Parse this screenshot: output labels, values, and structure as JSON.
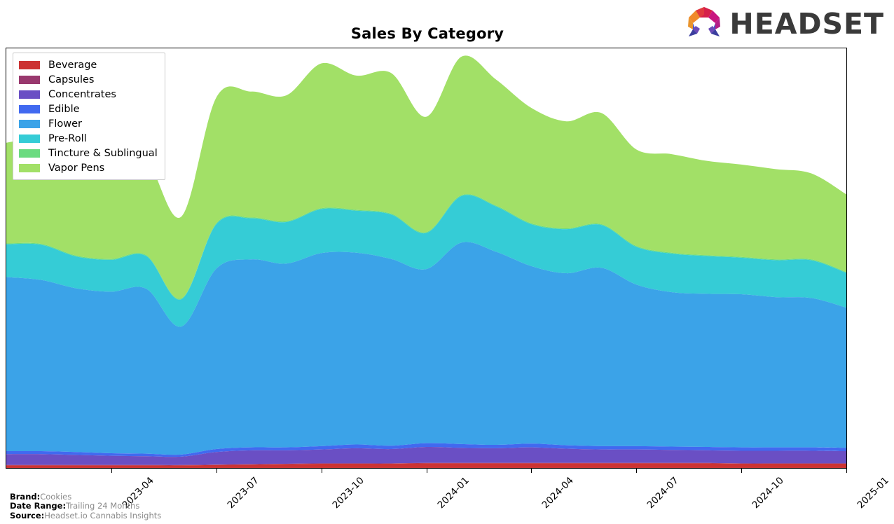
{
  "header": {
    "title": "Sales By Category",
    "logo_word": "HEADSET",
    "logo_icon": "headset-arch-logo"
  },
  "footer": {
    "brand_key": "Brand:",
    "brand_val": "Cookies",
    "date_range_key": "Date Range:",
    "date_range_val": "Trailing 24 Months",
    "source_key": "Source:",
    "source_val": "Headset.io Cannabis Insights"
  },
  "chart_data": {
    "type": "area",
    "stacked": true,
    "title": "Sales By Category",
    "xlabel": "",
    "ylabel": "",
    "grid": false,
    "legend_position": "upper left",
    "x": [
      "2023-01",
      "2023-02",
      "2023-03",
      "2023-04",
      "2023-05",
      "2023-06",
      "2023-07",
      "2023-08",
      "2023-09",
      "2023-10",
      "2023-11",
      "2023-12",
      "2024-01",
      "2024-02",
      "2024-03",
      "2024-04",
      "2024-05",
      "2024-06",
      "2024-07",
      "2024-08",
      "2024-09",
      "2024-10",
      "2024-11",
      "2024-12",
      "2025-01"
    ],
    "tick_labels": [
      "2023-04",
      "2023-07",
      "2023-10",
      "2024-01",
      "2024-04",
      "2024-07",
      "2024-10",
      "2025-01"
    ],
    "ylim": [
      0,
      100
    ],
    "colors": {
      "Beverage": "#CC3333",
      "Capsules": "#99386E",
      "Concentrates": "#6A4FC4",
      "Edible": "#4169F0",
      "Flower": "#3BA3E8",
      "Pre-Roll": "#35CCD6",
      "Tincture & Sublingual": "#6ADB80",
      "Vapor Pens": "#A2E067"
    },
    "series": [
      {
        "name": "Beverage",
        "values": [
          0.6,
          0.6,
          0.6,
          0.6,
          0.6,
          0.6,
          0.7,
          0.8,
          0.9,
          1.0,
          1.0,
          1.0,
          1.1,
          1.1,
          1.1,
          1.1,
          1.1,
          1.1,
          1.1,
          1.1,
          1.1,
          1.0,
          1.0,
          1.0,
          1.0
        ]
      },
      {
        "name": "Capsules",
        "values": [
          0.1,
          0.1,
          0.1,
          0.1,
          0.1,
          0.1,
          0.1,
          0.1,
          0.1,
          0.1,
          0.1,
          0.1,
          0.1,
          0.1,
          0.1,
          0.1,
          0.1,
          0.1,
          0.1,
          0.1,
          0.1,
          0.1,
          0.1,
          0.1,
          0.1
        ]
      },
      {
        "name": "Concentrates",
        "values": [
          2.6,
          2.6,
          2.4,
          2.2,
          2.1,
          2.0,
          3.0,
          3.3,
          3.2,
          3.3,
          3.6,
          3.4,
          3.8,
          3.6,
          3.5,
          3.7,
          3.4,
          3.2,
          3.2,
          3.1,
          3.0,
          3.0,
          3.0,
          3.0,
          2.9
        ]
      },
      {
        "name": "Edible",
        "values": [
          0.7,
          0.7,
          0.7,
          0.6,
          0.6,
          0.5,
          0.7,
          0.7,
          0.7,
          0.8,
          0.9,
          0.8,
          0.9,
          0.9,
          0.8,
          0.9,
          0.8,
          0.8,
          0.8,
          0.8,
          0.8,
          0.8,
          0.8,
          0.8,
          0.8
        ]
      },
      {
        "name": "Flower",
        "values": [
          41.5,
          40.8,
          39.0,
          38.5,
          39.3,
          30.5,
          43.0,
          44.8,
          43.8,
          46.0,
          45.7,
          44.5,
          41.5,
          48.0,
          46.0,
          42.3,
          41.0,
          42.5,
          38.5,
          36.8,
          36.5,
          36.5,
          35.8,
          35.6,
          33.4
        ]
      },
      {
        "name": "Pre-Roll",
        "values": [
          7.8,
          8.4,
          7.6,
          7.6,
          7.8,
          6.5,
          10.6,
          9.8,
          9.9,
          10.5,
          10.0,
          10.6,
          8.6,
          11.1,
          10.8,
          10.0,
          10.5,
          10.2,
          9.0,
          9.2,
          9.0,
          8.7,
          8.8,
          9.0,
          8.3
        ]
      },
      {
        "name": "Tincture & Sublingual",
        "values": [
          0.2,
          0.2,
          0.2,
          0.2,
          0.2,
          0.2,
          0.2,
          0.2,
          0.2,
          0.2,
          0.2,
          0.2,
          0.2,
          0.2,
          0.2,
          0.2,
          0.2,
          0.2,
          0.2,
          0.2,
          0.2,
          0.2,
          0.2,
          0.2,
          0.2
        ]
      },
      {
        "name": "Vapor Pens",
        "values": [
          24.0,
          25.5,
          28.5,
          27.0,
          23.0,
          19.5,
          30.0,
          30.0,
          30.0,
          34.5,
          32.0,
          33.5,
          27.5,
          33.0,
          30.0,
          27.5,
          25.5,
          26.5,
          23.0,
          23.5,
          22.5,
          22.0,
          21.5,
          20.5,
          18.5
        ]
      }
    ]
  }
}
